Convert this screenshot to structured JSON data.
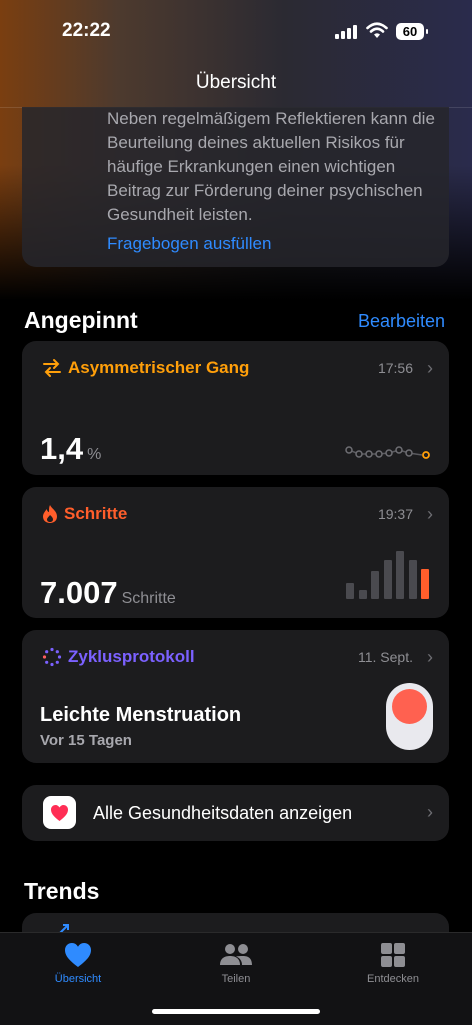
{
  "status": {
    "time": "22:22",
    "battery": "60"
  },
  "nav": {
    "title": "Übersicht"
  },
  "info": {
    "text": "Neben regelmäßigem Reflektieren kann die Beurteilung deines aktuellen Risikos für häufige Erkrankungen einen wichtigen Beitrag zur Förderung deiner psychischen Gesundheit leisten.",
    "link": "Fragebogen ausfüllen"
  },
  "pinned": {
    "title": "Angepinnt",
    "edit": "Bearbeiten"
  },
  "cards": {
    "gait": {
      "title": "Asymmetrischer Gang",
      "time": "17:56",
      "value": "1,4",
      "unit": "%",
      "color": "#ff9f0a"
    },
    "steps": {
      "title": "Schritte",
      "time": "19:37",
      "value": "7.007",
      "unit": "Schritte",
      "color": "#ff5e2b",
      "bars": [
        0.34,
        0.18,
        0.58,
        0.82,
        1.0,
        0.82,
        0.62
      ]
    },
    "cycle": {
      "title": "Zyklusprotokoll",
      "time": "11. Sept.",
      "main": "Leichte Menstruation",
      "sub": "Vor 15 Tagen",
      "color": "#7b61ff"
    }
  },
  "allData": {
    "label": "Alle Gesundheitsdaten anzeigen"
  },
  "trends": {
    "title": "Trends"
  },
  "tabs": [
    {
      "label": "Übersicht",
      "active": true
    },
    {
      "label": "Teilen",
      "active": false
    },
    {
      "label": "Entdecken",
      "active": false
    }
  ]
}
